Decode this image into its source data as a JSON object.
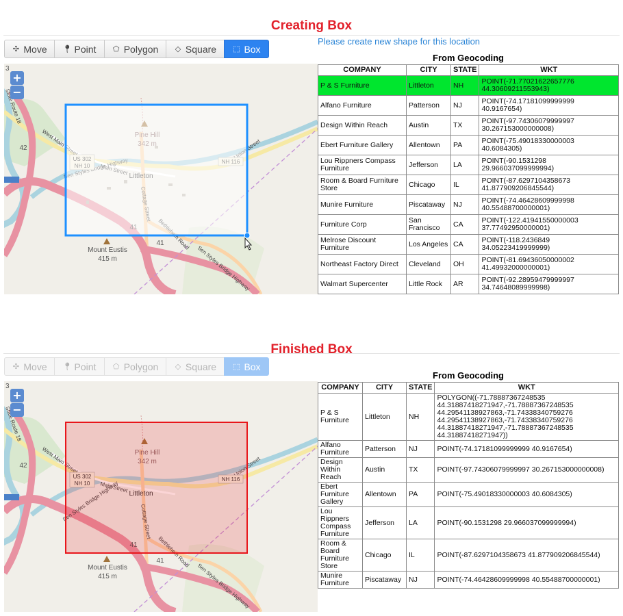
{
  "sections": {
    "creating_title": "Creating Box",
    "finished_title": "Finished Box"
  },
  "toolbar": {
    "move": "Move",
    "point": "Point",
    "polygon": "Polygon",
    "square": "Square",
    "box": "Box"
  },
  "notice": "Please create new shape for this location",
  "geocoding": {
    "title": "From Geocoding",
    "headers": [
      "COMPANY",
      "CITY",
      "STATE",
      "WKT"
    ]
  },
  "map_labels": {
    "pine_hill": "Pine Hill",
    "pine_hill_elev": "342 m",
    "mount_eustis": "Mount Eustis",
    "mount_eustis_elev": "415 m",
    "littleton": "Littleton",
    "main_street": "Main Street",
    "west_main_street": "West Main Street",
    "union_street": "Union Street",
    "cottage_street": "Cottage Street",
    "bethlehem_road": "Bethlehem Road",
    "sen_styles_bridge": "Sen Styles Bridge Highway",
    "sen_styles_bridge_2": "Sen Styles Bridge Highway",
    "route_18": "State Route 18",
    "us302": "US 302",
    "nh10": "NH 10",
    "nh116": "NH 116",
    "r42": "42",
    "r41": "41",
    "r41b": "41",
    "r3": "3"
  },
  "zoom": {
    "in": "+",
    "out": "−"
  },
  "table1": [
    {
      "company": "P & S Furniture",
      "city": "Littleton",
      "state": "NH",
      "wkt": "POINT(-71.77021622657776 44.30609211553943)"
    },
    {
      "company": "Alfano Furniture",
      "city": "Patterson",
      "state": "NJ",
      "wkt": "POINT(-74.17181099999999 40.9167654)"
    },
    {
      "company": "Design Within Reach",
      "city": "Austin",
      "state": "TX",
      "wkt": "POINT(-97.74306079999997 30.267153000000008)"
    },
    {
      "company": "Ebert Furniture Gallery",
      "city": "Allentown",
      "state": "PA",
      "wkt": "POINT(-75.49018330000003 40.6084305)"
    },
    {
      "company": "Lou Rippners Compass Furniture",
      "city": "Jefferson",
      "state": "LA",
      "wkt": "POINT(-90.1531298 29.966037099999994)"
    },
    {
      "company": "Room & Board Furniture Store",
      "city": "Chicago",
      "state": "IL",
      "wkt": "POINT(-87.6297104358673 41.877909206845544)"
    },
    {
      "company": "Munire Furniture",
      "city": "Piscataway",
      "state": "NJ",
      "wkt": "POINT(-74.46428609999998 40.55488700000001)"
    },
    {
      "company": "Furniture Corp",
      "city": "San Francisco",
      "state": "CA",
      "wkt": "POINT(-122.41941550000003 37.77492950000001)"
    },
    {
      "company": "Melrose Discount Furniture",
      "city": "Los Angeles",
      "state": "CA",
      "wkt": "POINT(-118.2436849 34.05223419999999)"
    },
    {
      "company": "Northeast Factory Direct",
      "city": "Cleveland",
      "state": "OH",
      "wkt": "POINT(-81.69436050000002 41.49932000000001)"
    },
    {
      "company": "Walmart Supercenter",
      "city": "Little Rock",
      "state": "AR",
      "wkt": "POINT(-92.28959479999997 34.74648089999998)"
    }
  ],
  "table2": [
    {
      "company": "P & S Furniture",
      "city": "Littleton",
      "state": "NH",
      "wkt": "POLYGON((-71.78887367248535 44.31887418271947,-71.78887367248535 44.29541138927863,-71.74338340759276 44.29541138927863,-71.74338340759276 44.31887418271947,-71.78887367248535 44.31887418271947))"
    },
    {
      "company": "Alfano Furniture",
      "city": "Patterson",
      "state": "NJ",
      "wkt": "POINT(-74.17181099999999 40.9167654)"
    },
    {
      "company": "Design Within Reach",
      "city": "Austin",
      "state": "TX",
      "wkt": "POINT(-97.74306079999997 30.267153000000008)"
    },
    {
      "company": "Ebert Furniture Gallery",
      "city": "Allentown",
      "state": "PA",
      "wkt": "POINT(-75.49018330000003 40.6084305)"
    },
    {
      "company": "Lou Rippners Compass Furniture",
      "city": "Jefferson",
      "state": "LA",
      "wkt": "POINT(-90.1531298 29.966037099999994)"
    },
    {
      "company": "Room & Board Furniture Store",
      "city": "Chicago",
      "state": "IL",
      "wkt": "POINT(-87.6297104358673 41.877909206845544)"
    },
    {
      "company": "Munire Furniture",
      "city": "Piscataway",
      "state": "NJ",
      "wkt": "POINT(-74.46428609999998 40.55488700000001)"
    }
  ],
  "colors": {
    "title_red": "#e2212b",
    "active_blue": "#2d83f0",
    "highlight_green": "#00e62e",
    "box_drawing": "#1e90ff",
    "box_finished": "#e8161b"
  }
}
